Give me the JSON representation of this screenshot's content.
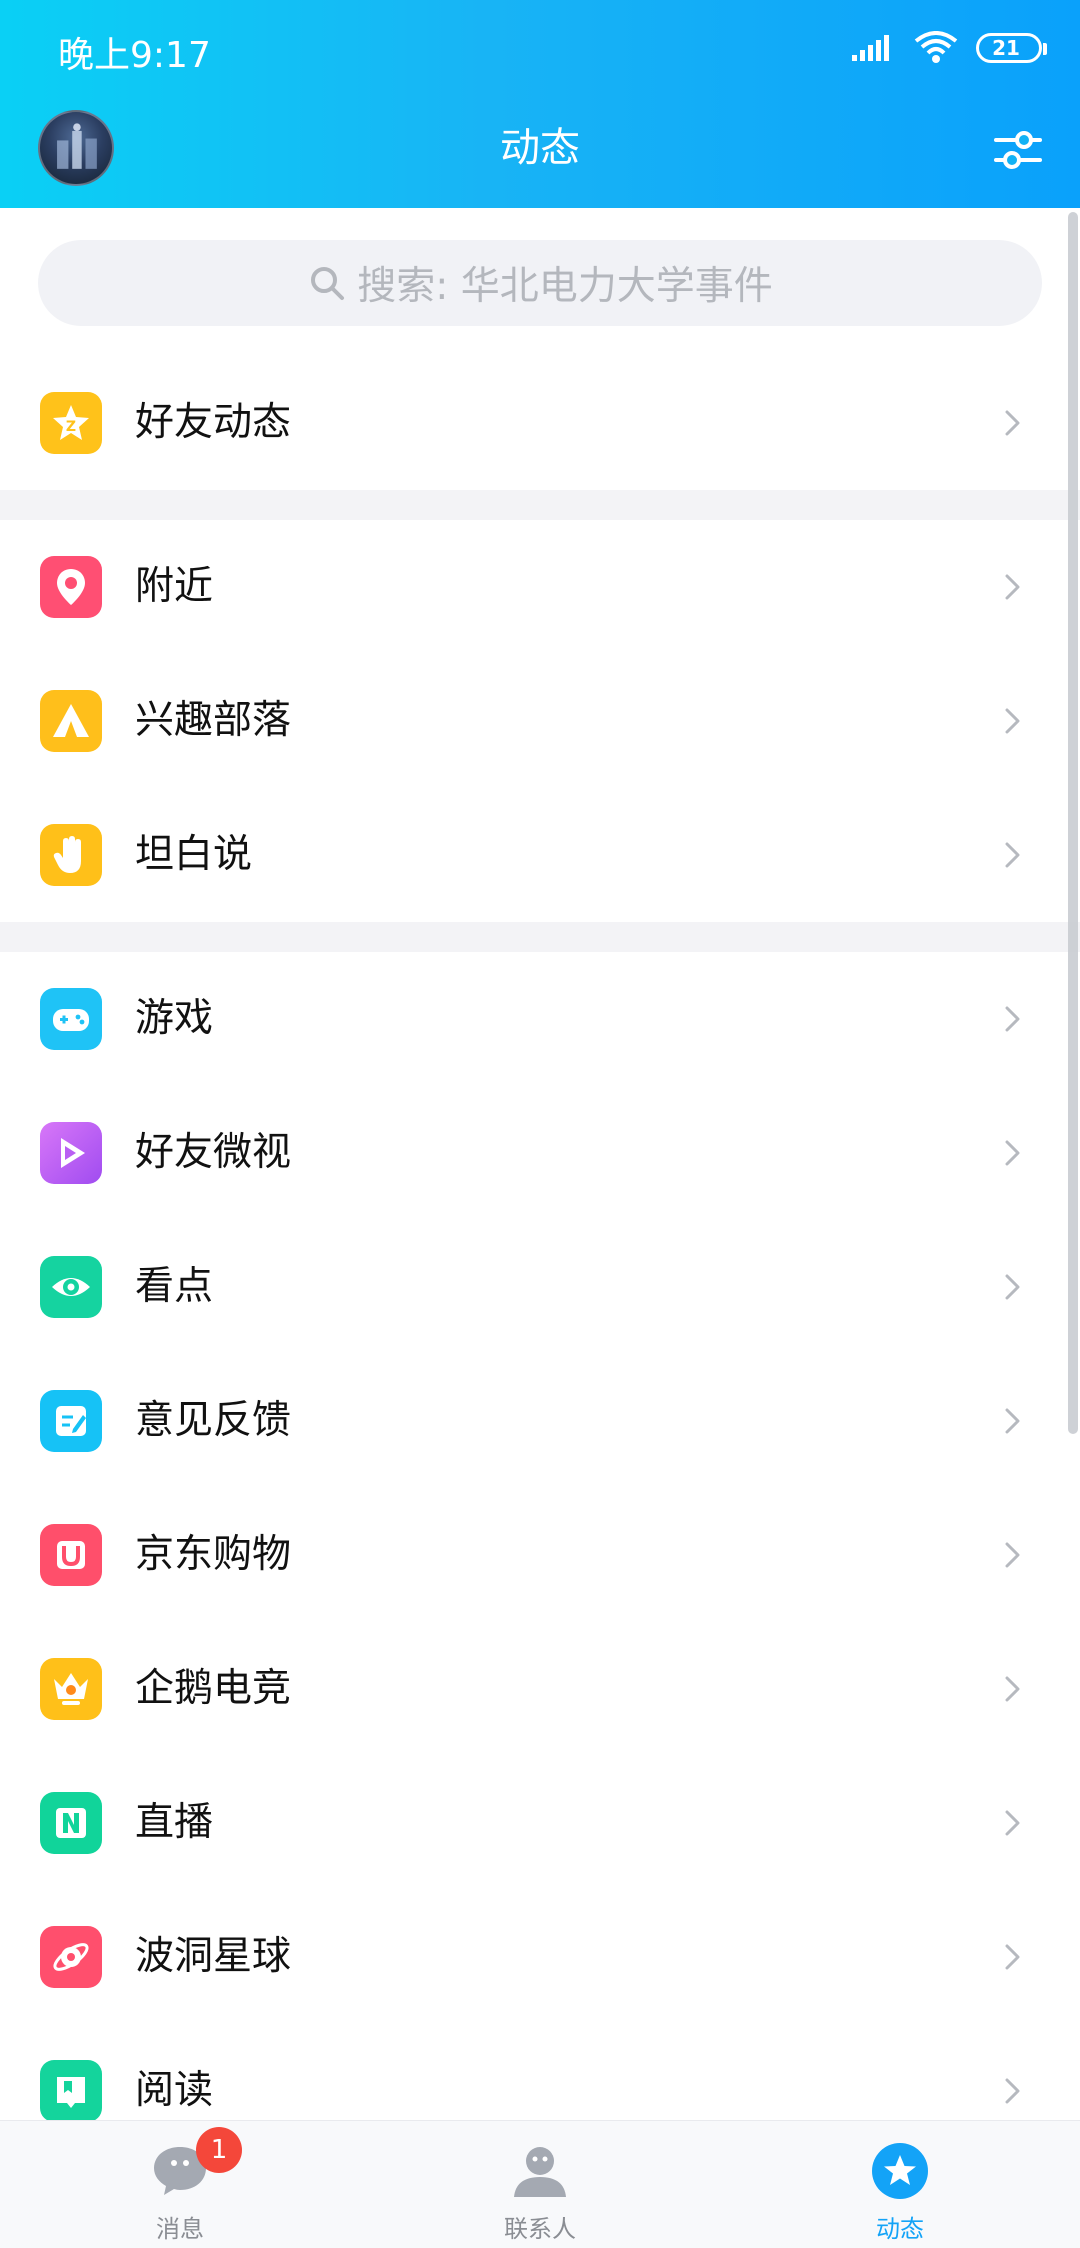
{
  "status_bar": {
    "time": "晚上9:17",
    "battery": "21"
  },
  "header": {
    "title": "动态"
  },
  "search": {
    "placeholder": "搜索: 华北电力大学事件"
  },
  "sections": [
    [
      {
        "label": "好友动态",
        "icon": "qzone-star-icon",
        "color": "#ffc21a"
      }
    ],
    [
      {
        "label": "附近",
        "icon": "location-pin-icon",
        "color": "#ff4f73"
      },
      {
        "label": "兴趣部落",
        "icon": "tribe-tent-icon",
        "color": "#ffbf1b"
      },
      {
        "label": "坦白说",
        "icon": "hand-icon",
        "color": "#ffc019"
      }
    ],
    [
      {
        "label": "游戏",
        "icon": "gamepad-icon",
        "color": "#1fc3f6"
      },
      {
        "label": "好友微视",
        "icon": "weishi-play-icon",
        "color": "#c460f3"
      },
      {
        "label": "看点",
        "icon": "eye-icon",
        "color": "#15d3a0"
      },
      {
        "label": "意见反馈",
        "icon": "feedback-edit-icon",
        "color": "#16c2f6"
      },
      {
        "label": "京东购物",
        "icon": "jd-bag-icon",
        "color": "#ff4f6b"
      },
      {
        "label": "企鹅电竞",
        "icon": "esports-crown-icon",
        "color": "#ffc019"
      },
      {
        "label": "直播",
        "icon": "live-n-icon",
        "color": "#11d49a"
      },
      {
        "label": "波洞星球",
        "icon": "planet-icon",
        "color": "#ff4f6d"
      },
      {
        "label": "阅读",
        "icon": "book-icon",
        "color": "#14d49c"
      }
    ]
  ],
  "tabs": [
    {
      "label": "消息",
      "icon": "chat-bubble-icon",
      "badge": "1"
    },
    {
      "label": "联系人",
      "icon": "contact-person-icon"
    },
    {
      "label": "动态",
      "icon": "star-circle-icon"
    }
  ],
  "colors": {
    "accent": "#13a3f7",
    "badge": "#f4473a",
    "header_start": "#0ad0f5",
    "header_end": "#0aa1fb"
  }
}
